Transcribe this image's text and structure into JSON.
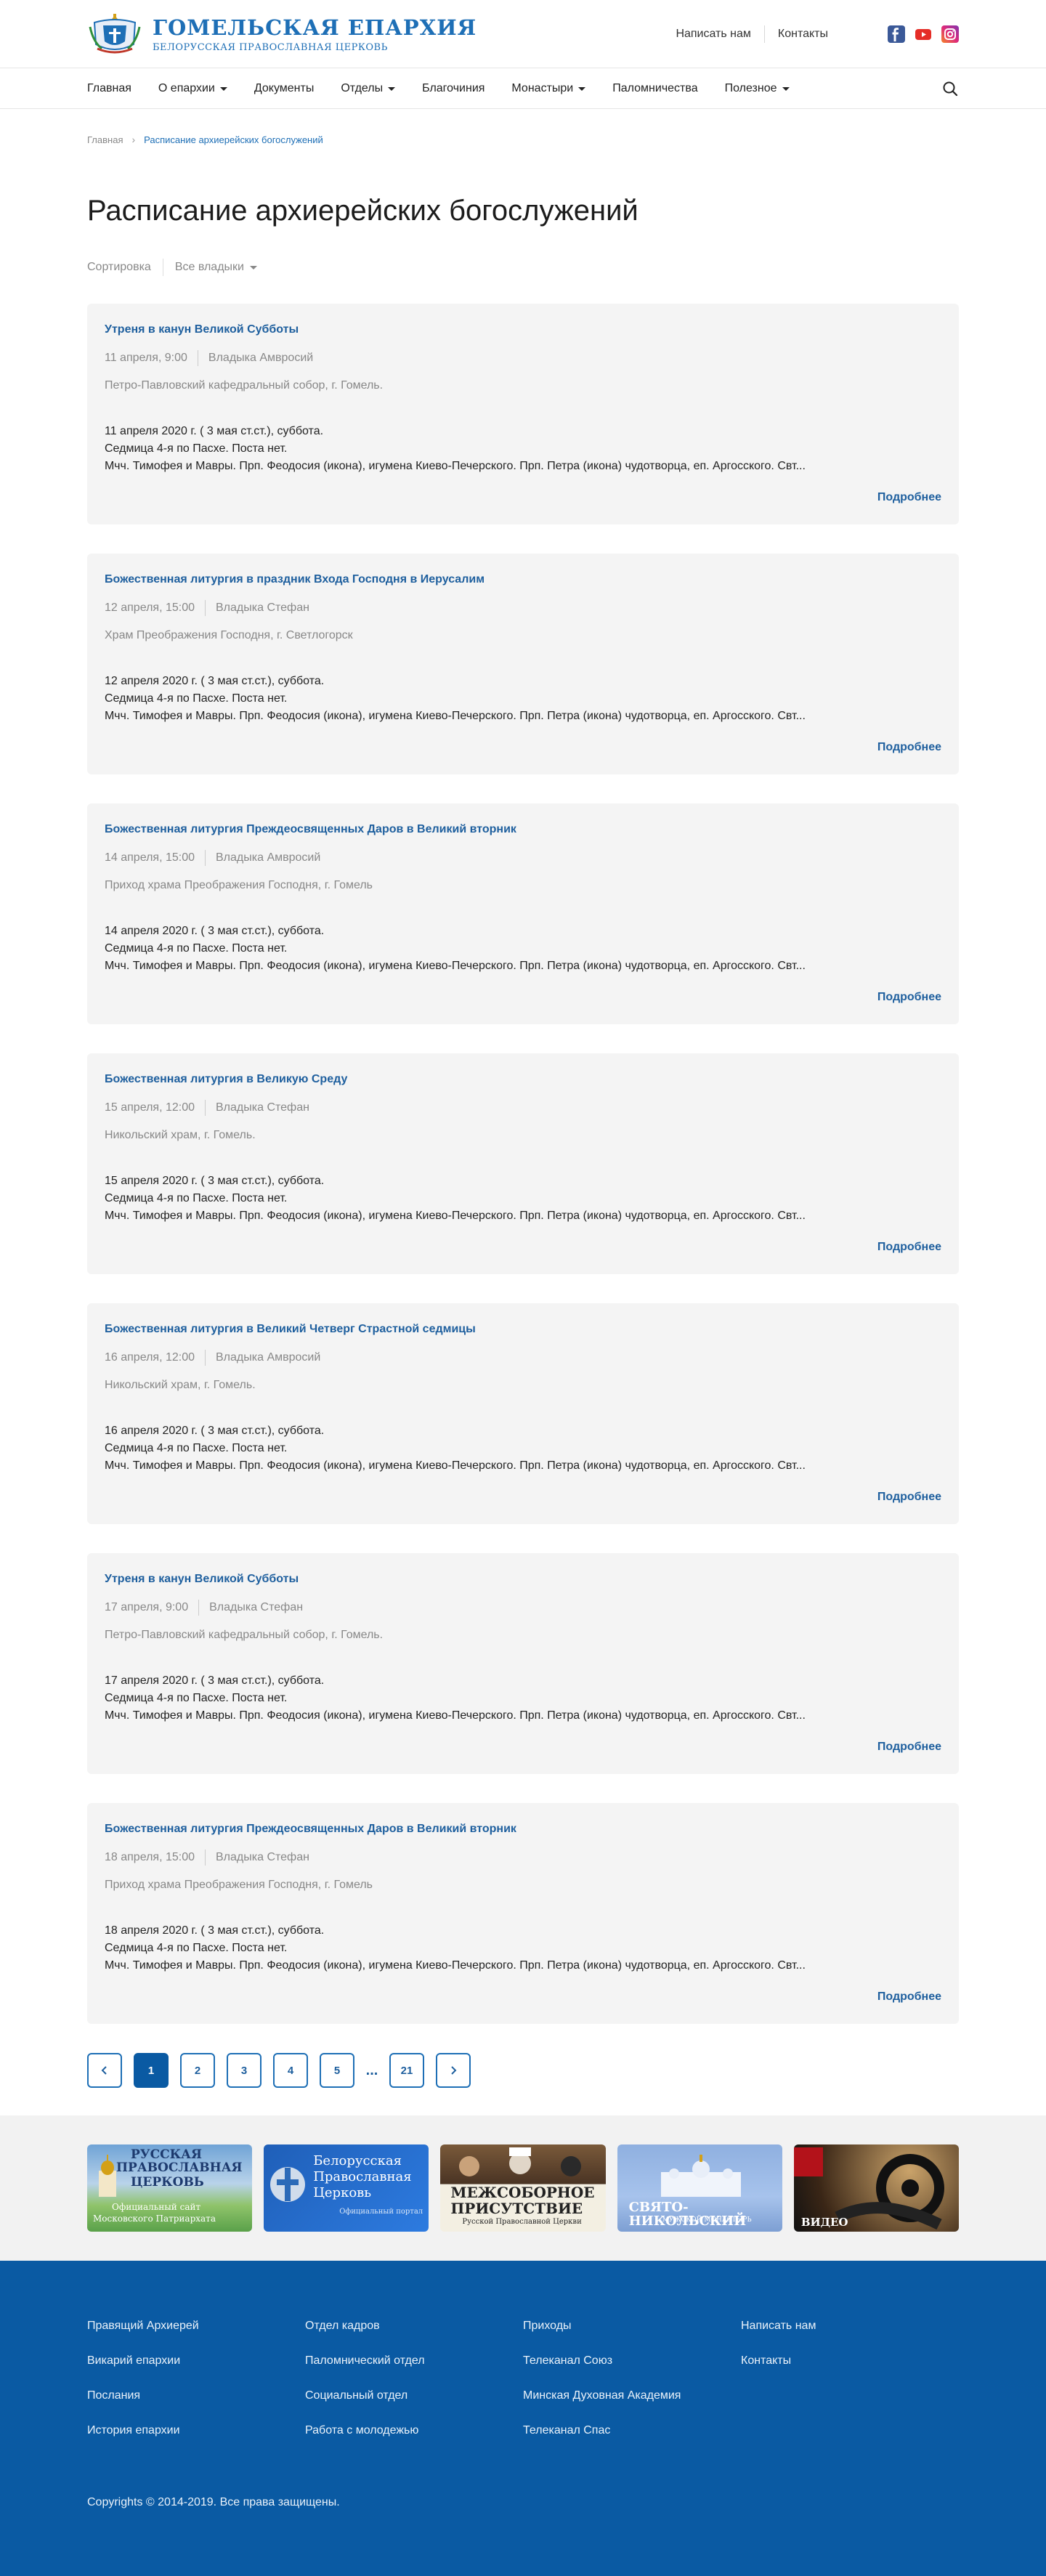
{
  "header": {
    "logo_title": "ГОМЕЛЬСКАЯ ЕПАРХИЯ",
    "logo_subtitle": "БЕЛОРУССКАЯ ПРАВОСЛАВНАЯ ЦЕРКОВЬ",
    "write_us": "Написать нам",
    "contacts": "Контакты",
    "socials": [
      "facebook-icon",
      "youtube-icon",
      "instagram-icon"
    ],
    "colors": {
      "facebook": "#3b5998",
      "youtube": "#e52d27",
      "instagram": "#d6249f"
    }
  },
  "nav": {
    "items": [
      "Главная",
      "О епархии",
      "Документы",
      "Отделы",
      "Благочиния",
      "Монастыри",
      "Паломничества",
      "Полезное"
    ],
    "dropdown": [
      false,
      true,
      false,
      true,
      false,
      true,
      false,
      true
    ]
  },
  "breadcrumb": {
    "home": "Главная",
    "current": "Расписание архиерейских богослужений"
  },
  "page": {
    "title": "Расписание архиерейских богослужений",
    "sort_label": "Сортировка",
    "sort_value": "Все владыки"
  },
  "more_label": "Подробнее",
  "cards": [
    {
      "title": "Утреня в канун Великой Субботы",
      "date": "11 апреля, 9:00",
      "bishop": "Владыка Амвросий",
      "place": "Петро-Павловский кафедральный собор, г. Гомель.",
      "line1": "11 апреля 2020 г. ( 3 мая ст.ст.), суббота.",
      "line2": "Седмица 4-я по Пасхе. Поста нет.",
      "line3": "Мчч. Тимофея и Мавры. Прп. Феодосия (икона), игумена Киево-Печерского. Прп. Петра (икона) чудотворца, еп. Аргосского. Свт..."
    },
    {
      "title": "Божественная литургия в праздник Входа Господня в Иерусалим",
      "date": "12 апреля, 15:00",
      "bishop": "Владыка Стефан",
      "place": "Храм Преображения Господня, г. Светлогорск",
      "line1": "12 апреля 2020 г. ( 3 мая ст.ст.), суббота.",
      "line2": "Седмица 4-я по Пасхе. Поста нет.",
      "line3": "Мчч. Тимофея и Мавры. Прп. Феодосия (икона), игумена Киево-Печерского. Прп. Петра (икона) чудотворца, еп. Аргосского. Свт..."
    },
    {
      "title": "Божественная литургия Преждеосвященных Даров в Великий вторник",
      "date": "14 апреля, 15:00",
      "bishop": "Владыка Амвросий",
      "place": "Приход храма Преображения Господня, г. Гомель",
      "line1": "14 апреля 2020 г. ( 3 мая ст.ст.), суббота.",
      "line2": "Седмица 4-я по Пасхе. Поста нет.",
      "line3": "Мчч. Тимофея и Мавры. Прп. Феодосия (икона), игумена Киево-Печерского. Прп. Петра (икона) чудотворца, еп. Аргосского. Свт..."
    },
    {
      "title": "Божественная литургия в Великую Среду",
      "date": "15 апреля, 12:00",
      "bishop": "Владыка Стефан",
      "place": "Никольский храм, г. Гомель.",
      "line1": "15 апреля 2020 г. ( 3 мая ст.ст.), суббота.",
      "line2": "Седмица 4-я по Пасхе. Поста нет.",
      "line3": "Мчч. Тимофея и Мавры. Прп. Феодосия (икона), игумена Киево-Печерского. Прп. Петра (икона) чудотворца, еп. Аргосского. Свт..."
    },
    {
      "title": "Божественная литургия в Великий Четверг Страстной седмицы",
      "date": "16 апреля, 12:00",
      "bishop": "Владыка Амвросий",
      "place": " Никольский храм, г. Гомель.",
      "line1": "16 апреля 2020 г. ( 3 мая ст.ст.), суббота.",
      "line2": "Седмица 4-я по Пасхе. Поста нет.",
      "line3": "Мчч. Тимофея и Мавры. Прп. Феодосия (икона), игумена Киево-Печерского. Прп. Петра (икона) чудотворца, еп. Аргосского. Свт..."
    },
    {
      "title": "Утреня в канун Великой Субботы",
      "date": "17 апреля, 9:00",
      "bishop": "Владыка Стефан",
      "place": "Петро-Павловский кафедральный собор, г. Гомель.",
      "line1": "17 апреля 2020 г. ( 3 мая ст.ст.), суббота.",
      "line2": "Седмица 4-я по Пасхе. Поста нет.",
      "line3": "Мчч. Тимофея и Мавры. Прп. Феодосия (икона), игумена Киево-Печерского. Прп. Петра (икона) чудотворца, еп. Аргосского. Свт..."
    },
    {
      "title": "Божественная литургия Преждеосвященных Даров в Великий вторник",
      "date": "18 апреля, 15:00",
      "bishop": "Владыка Стефан",
      "place": "Приход храма Преображения Господня, г. Гомель",
      "line1": "18 апреля 2020 г. ( 3 мая ст.ст.), суббота.",
      "line2": "Седмица 4-я по Пасхе. Поста нет.",
      "line3": "Мчч. Тимофея и Мавры. Прп. Феодосия (икона), игумена Киево-Печерского. Прп. Петра (икона) чудотворца, еп. Аргосского. Свт..."
    }
  ],
  "pagination": {
    "pages": [
      "1",
      "2",
      "3",
      "4",
      "5"
    ],
    "dots": "...",
    "last": "21",
    "current": "1"
  },
  "banners": {
    "b1": {
      "l1": "РУССКАЯ",
      "l2": "ПРАВОСЛАВНАЯ",
      "l3": "ЦЕРКОВЬ",
      "l4": "Официальный сайт",
      "l5": "Московского Патриархата"
    },
    "b2": {
      "l1": "Белорусская",
      "l2": "Православная",
      "l3": "Церковь",
      "l4": "Официальный портал"
    },
    "b3": {
      "l1": "МЕЖСОБОРНОЕ",
      "l2": "ПРИСУТСТВИЕ",
      "l3": "Русской Православной Церкви"
    },
    "b4": {
      "l1": "СВЯТО-НИКОЛЬСКИЙ",
      "l2": "МУЖСКОЙ МОНАСТЫРЬ"
    },
    "b5": {
      "l1": "ВИДЕО"
    }
  },
  "footer": {
    "col1": [
      "Правящий Архиерей",
      "Викарий епархии",
      "Послания",
      "История епархии"
    ],
    "col2": [
      "Отдел кадров",
      "Паломнический отдел",
      "Социальный отдел",
      "Работа с молодежью"
    ],
    "col3": [
      "Приходы",
      "Телеканал Союз",
      "Минская Духовная Академия",
      "Телеканал Спас"
    ],
    "col4": [
      "Написать нам",
      "Контакты"
    ],
    "copyright": "Copyrights © 2014-2019. Все права защищены."
  }
}
